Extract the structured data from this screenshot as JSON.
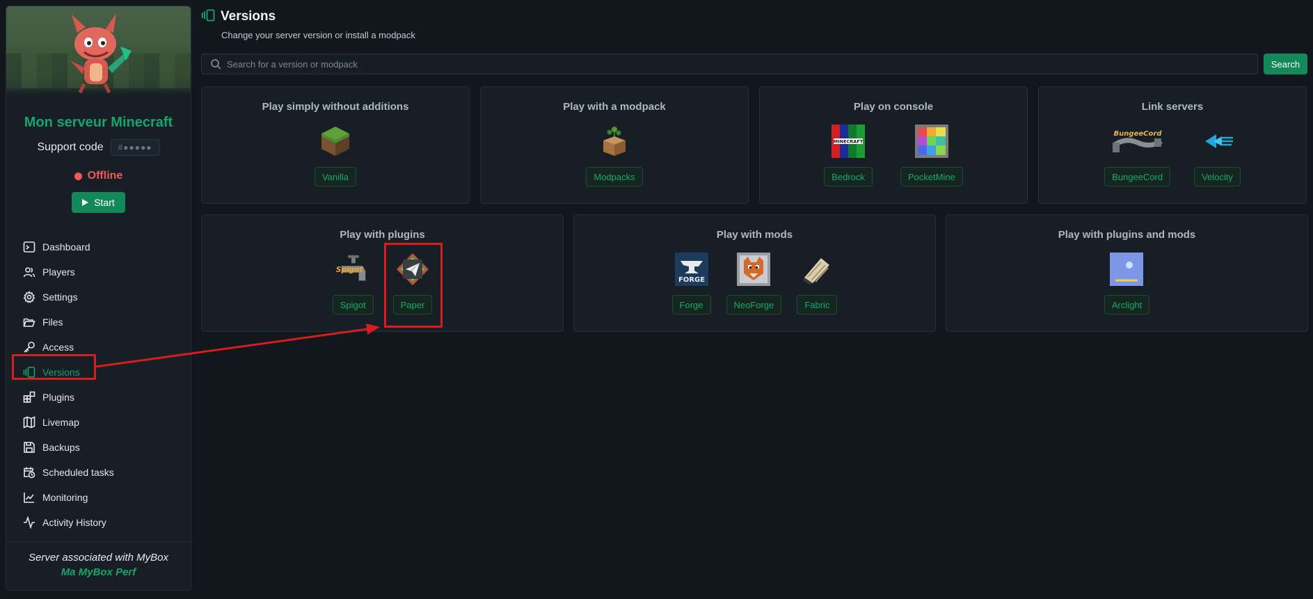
{
  "sidebar": {
    "server_name": "Mon serveur Minecraft",
    "support_label": "Support code",
    "support_code": "#●●●●●",
    "status": "Offline",
    "start_label": "Start",
    "items": [
      {
        "label": "Dashboard",
        "icon": "terminal-icon"
      },
      {
        "label": "Players",
        "icon": "users-icon"
      },
      {
        "label": "Settings",
        "icon": "gear-icon"
      },
      {
        "label": "Files",
        "icon": "folder-icon"
      },
      {
        "label": "Access",
        "icon": "key-icon"
      },
      {
        "label": "Versions",
        "icon": "versions-icon"
      },
      {
        "label": "Plugins",
        "icon": "plugins-icon"
      },
      {
        "label": "Livemap",
        "icon": "map-icon"
      },
      {
        "label": "Backups",
        "icon": "save-icon"
      },
      {
        "label": "Scheduled tasks",
        "icon": "calendar-clock-icon"
      },
      {
        "label": "Monitoring",
        "icon": "chart-icon"
      },
      {
        "label": "Activity History",
        "icon": "activity-icon"
      }
    ],
    "footer_line1": "Server associated with MyBox",
    "footer_line2": "Ma MyBox Perf"
  },
  "header": {
    "title": "Versions",
    "subtitle": "Change your server version or install a modpack"
  },
  "search": {
    "placeholder": "Search for a version or modpack",
    "button": "Search"
  },
  "cards": [
    {
      "title": "Play simply without additions",
      "options": [
        "Vanilla"
      ]
    },
    {
      "title": "Play with a modpack",
      "options": [
        "Modpacks"
      ]
    },
    {
      "title": "Play on console",
      "options": [
        "Bedrock",
        "PocketMine"
      ]
    },
    {
      "title": "Link servers",
      "options": [
        "BungeeCord",
        "Velocity"
      ]
    },
    {
      "title": "Play with plugins",
      "options": [
        "Spigot",
        "Paper"
      ]
    },
    {
      "title": "Play with mods",
      "options": [
        "Forge",
        "NeoForge",
        "Fabric"
      ]
    },
    {
      "title": "Play with plugins and mods",
      "options": [
        "Arclight"
      ]
    }
  ],
  "logo_text": {
    "bedrock": "MINECRAFT",
    "bungeecord": "BungeeCord",
    "spigot": "Spigot",
    "forge": "FORGE"
  },
  "colors": {
    "accent": "#13895a",
    "accent_text": "#19a46b",
    "offline": "#f05a5a",
    "annotation": "#d71d1d"
  }
}
